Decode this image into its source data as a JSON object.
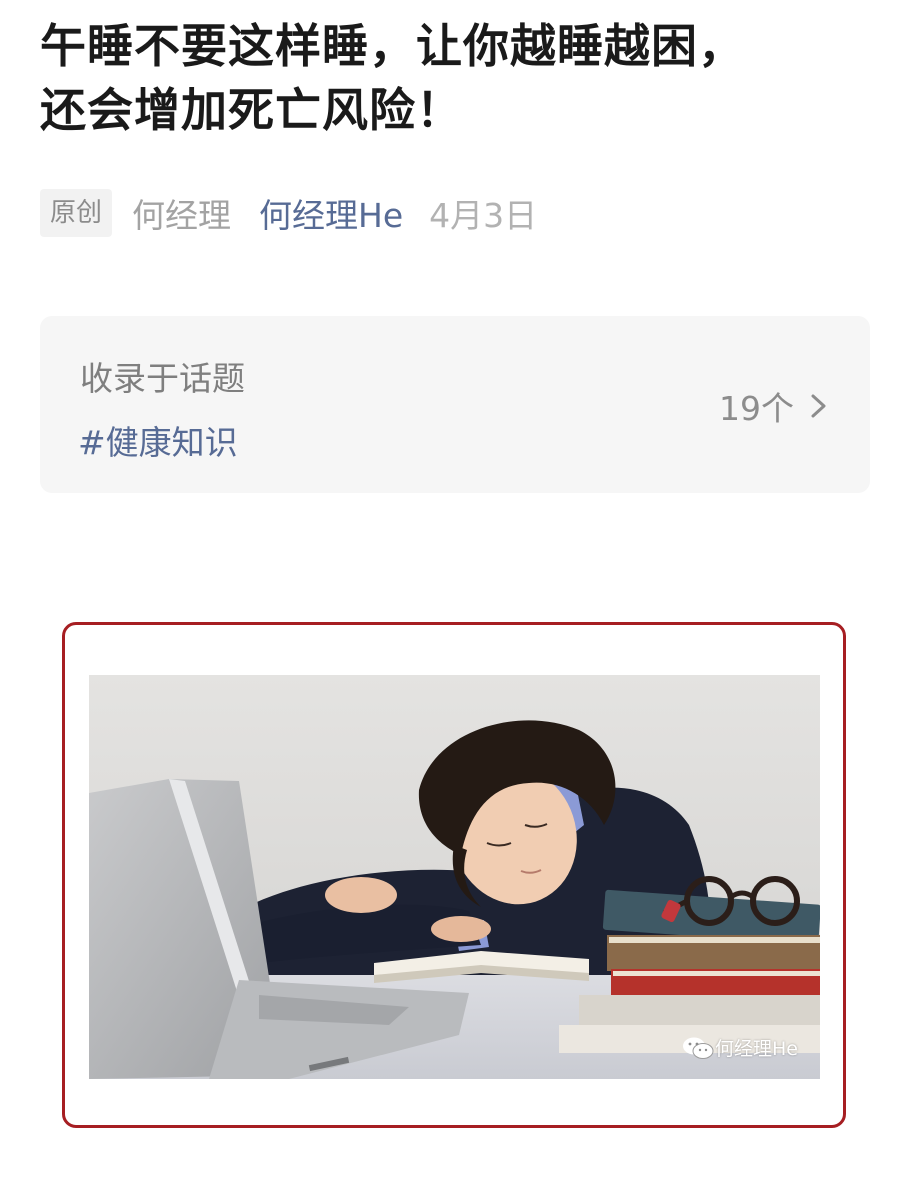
{
  "article": {
    "title_line1": "午睡不要这样睡，让你越睡越困，",
    "title_line2": "还会增加死亡风险！",
    "badge": "原创",
    "author": "何经理",
    "account": "何经理He",
    "date": "4月3日"
  },
  "topic": {
    "label": "收录于话题",
    "tag": "#健康知识",
    "count": "19个"
  },
  "image": {
    "watermark": "何经理He"
  },
  "colors": {
    "link": "#576b95",
    "frame": "#a61e22",
    "card_bg": "#f6f6f6"
  }
}
